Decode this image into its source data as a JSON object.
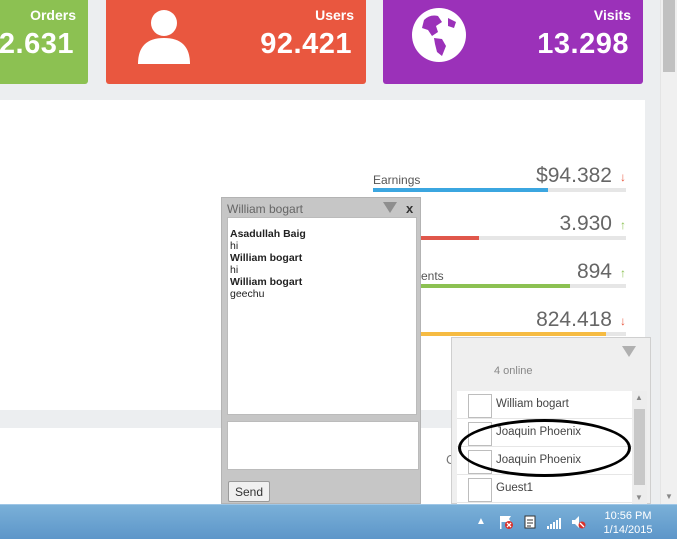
{
  "tiles": {
    "orders": {
      "label": "Orders",
      "value": "2.631"
    },
    "users": {
      "label": "Users",
      "value": "92.421"
    },
    "visits": {
      "label": "Visits",
      "value": "13.298"
    }
  },
  "stats": [
    {
      "name": "Earnings",
      "value": "$94.382",
      "trend": "down",
      "fill": 0.69,
      "color": "#3ba6e0"
    },
    {
      "name": "",
      "value": "3.930",
      "trend": "up",
      "fill": 0.42,
      "color": "#e0574b"
    },
    {
      "name": "ents",
      "value": "894",
      "trend": "up",
      "fill": 0.78,
      "color": "#8cc152"
    },
    {
      "name": "",
      "value": "824.418",
      "trend": "down",
      "fill": 0.92,
      "color": "#f6bb42"
    }
  ],
  "chat": {
    "title": "William bogart",
    "close": "x",
    "messages": [
      {
        "from": "Asadullah Baig",
        "text": "hi"
      },
      {
        "from": "William bogart",
        "text": "hi"
      },
      {
        "from": "William bogart",
        "text": "geechu"
      }
    ],
    "send_label": "Send"
  },
  "online": {
    "count": "4 online",
    "users": [
      "William bogart",
      "Joaquin Phoenix",
      "Joaquin Phoenix",
      "Guest1"
    ]
  },
  "partial_text": "C",
  "taskbar": {
    "time": "10:56 PM",
    "date": "1/14/2015"
  },
  "colors": {
    "orders": "#8cc152",
    "users": "#e9573f",
    "visits": "#9b31b9",
    "up_arrow": "#8cc152",
    "down_arrow": "#e9573f"
  },
  "icons": [
    "user-icon",
    "globe-icon",
    "minimize-icon",
    "close-icon",
    "flag-icon",
    "notes-icon",
    "signal-icon",
    "mute-icon"
  ]
}
